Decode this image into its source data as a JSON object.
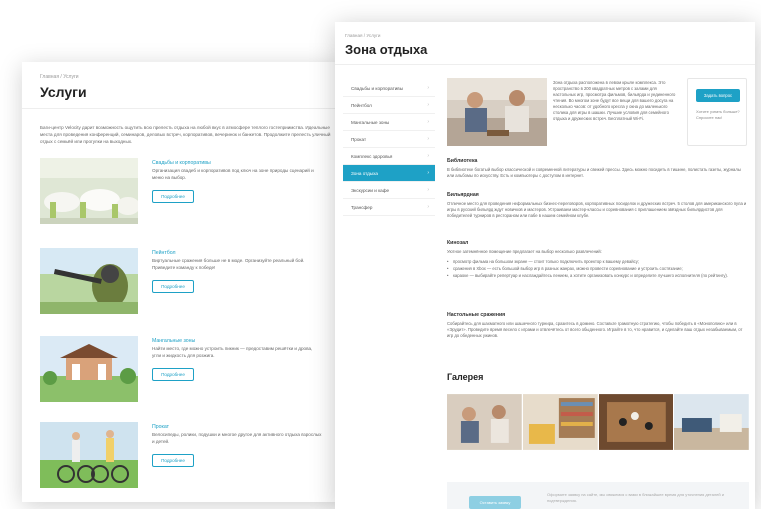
{
  "services_page": {
    "breadcrumb": "Главная  /  Услуги",
    "title": "Услуги",
    "intro": "Баги-центр Velocity дарит возможность ощутить всю прелесть отдыха на любой вкус в атмосфере теплого гостеприимства. Идеальные места для проведения конференций, семинаров, деловых встреч, корпоративов, вечеринок и банкетов. Продолжите прелесть уличный отдых с семьёй или прогулки на выходных.",
    "items": [
      {
        "title": "Свадьбы и корпоративы",
        "desc": "Организация свадеб и корпоративов под ключ на зоне природы сценарий и меню на выбор.",
        "button": "Подробнее"
      },
      {
        "title": "Пейнтбол",
        "desc": "Виртуальные сражения больше не в моде. Организуйте реальный бой. Приведите команду к победе!",
        "button": "Подробнее"
      },
      {
        "title": "Мангальные зоны",
        "desc": "Найти место, где можно устроить пикник — предоставим решётки и дрова, угли и жидкость для розжига.",
        "button": "Подробнее"
      },
      {
        "title": "Прокат",
        "desc": "Велосипеды, ролики, подушки и многое другое для активного отдыха взрослых и детей.",
        "button": "Подробнее"
      }
    ]
  },
  "zone_page": {
    "breadcrumb": "Главная  /  Услуги",
    "title": "Зона отдыха",
    "sidebar": [
      {
        "label": "Свадьбы и корпоративы",
        "active": false
      },
      {
        "label": "Пейнтбол",
        "active": false
      },
      {
        "label": "Мангальные зоны",
        "active": false
      },
      {
        "label": "Прокат",
        "active": false
      },
      {
        "label": "Комплекс здоровья",
        "active": false
      },
      {
        "label": "Зона отдыха",
        "active": true
      },
      {
        "label": "Экскурсии и кафе",
        "active": false
      },
      {
        "label": "Трансфер",
        "active": false
      }
    ],
    "hero_text": "Зона отдыха расположена в левом крыле комплекса. Это пространство в 200 квадратных метров с залами для настольных игр, просмотра фильмов, бильярда и уединенного чтения. Во многом зоне будут все вещи для вашего досуга на несколько часов: от удобного кресла у окна до маленького столика для игры в шашки. Лучшие условия для семейного отдыха и дружеских встреч. Бесплатный Wi-Fi.",
    "cta": {
      "button": "Задать вопрос",
      "note": "Хотите узнать больше? Спросите нас!"
    },
    "sections": [
      {
        "heading": "Библиотека",
        "text": "В библиотеке богатый выбор классической и современной литературы и свежей прессы. Здесь можно посидеть в тишине, полистать газеты, журналы или альбомы по искусству. Есть и компьютеры с доступом в интернет."
      },
      {
        "heading": "Бильярдная",
        "text": "Отличное место для проведения неформальных бизнес-переговоров, корпоративных посиделок и дружеских встреч. 5 столов для американского пула и игры в русский бильярд ждут новичков и мастеров. Устраиваем мастер-классы и соревнования с приглашением звёздных бильярдистов для победителей турниров в рестораном или пабе в нашем семейном клубе."
      },
      {
        "heading": "Кинозал",
        "text": "Уютное затемнённое помещение предлагает на выбор несколько развлечений:"
      }
    ],
    "cinema_list": [
      "просмотр фильма на большом экране — стоит только подключить проектор к вашему девайсу;",
      "сражения в Xbox — есть большой выбор игр в разных жанрах, можно провести соревнование и устроить состязание;",
      "караоке — выбирайте репертуар и наслаждайтесь пением, а хотите организовать конкурс и определите лучшего исполнителя (по рейтингу)."
    ],
    "tabletop": {
      "heading": "Настольные сражения",
      "text": "Собирайтесь для шахматного или шашечного турнира, сразитесь в домино. Составьте грамотную стратегию, чтобы победить в «Монополию» или в «Эрудит». Проведите время весело с играми и отвлечётесь от всего обыденного. Играйте в то, что нравится, и сделайте ваш отдых незабываемым, от игр до обеденных ужинов."
    },
    "gallery_title": "Галерея",
    "footer": {
      "button": "Оставить заявку",
      "text": "Оформите заявку на сайте, мы свяжемся с вами в ближайшее время для уточнения деталей и подтверждения."
    }
  },
  "colors": {
    "accent": "#1ea1c6",
    "muted_accent": "#8ecfe3",
    "footer_band": "#f3f5f7"
  }
}
